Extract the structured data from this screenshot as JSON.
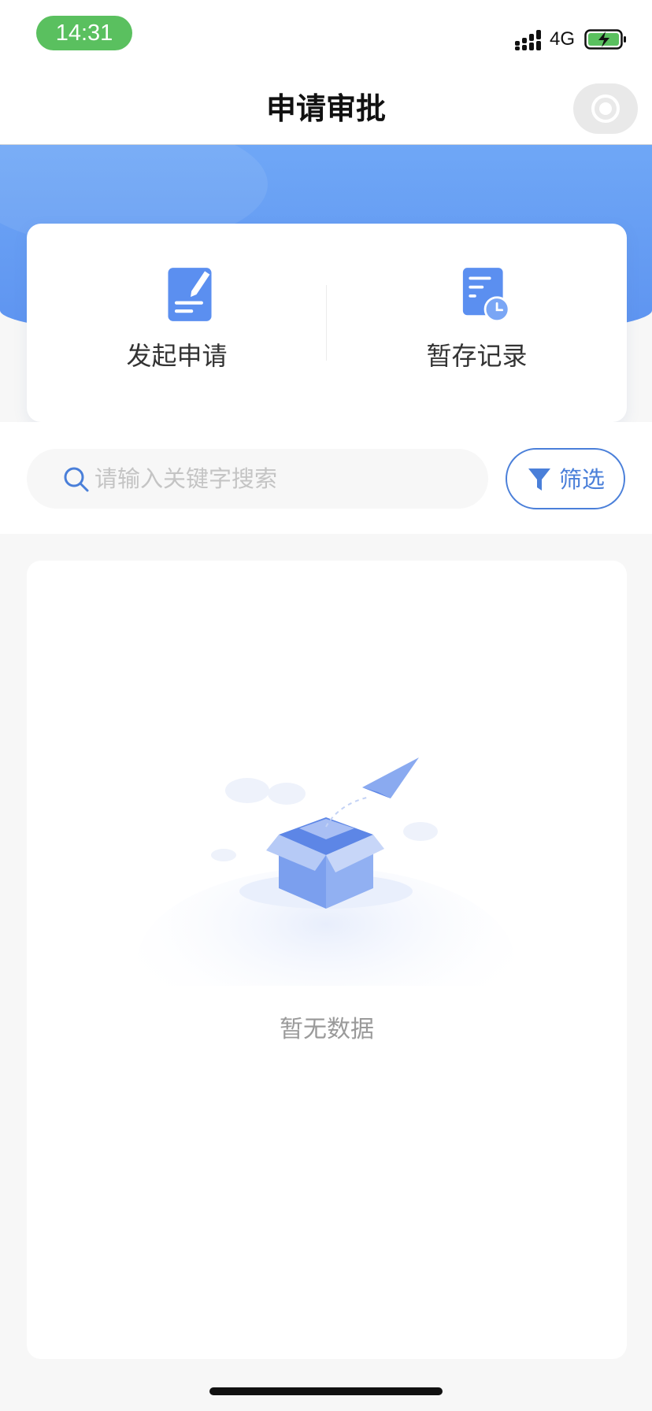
{
  "status_bar": {
    "time": "14:31",
    "network": "4G",
    "signal_icon": "signal-bars-icon",
    "battery_icon": "battery-charging-icon",
    "time_pill_color": "#5ac05f"
  },
  "nav": {
    "title": "申请审批",
    "capsule_icon": "target-icon"
  },
  "actions": [
    {
      "label": "发起申请",
      "icon": "edit-document-icon"
    },
    {
      "label": "暂存记录",
      "icon": "document-clock-icon"
    }
  ],
  "search": {
    "placeholder": "请输入关键字搜索",
    "value": ""
  },
  "filter": {
    "label": "筛选",
    "icon": "funnel-icon"
  },
  "list": {
    "empty_text": "暂无数据",
    "empty_icon": "empty-box-icon"
  },
  "colors": {
    "accent": "#4a7fd9",
    "banner": "#6fa7f6"
  }
}
